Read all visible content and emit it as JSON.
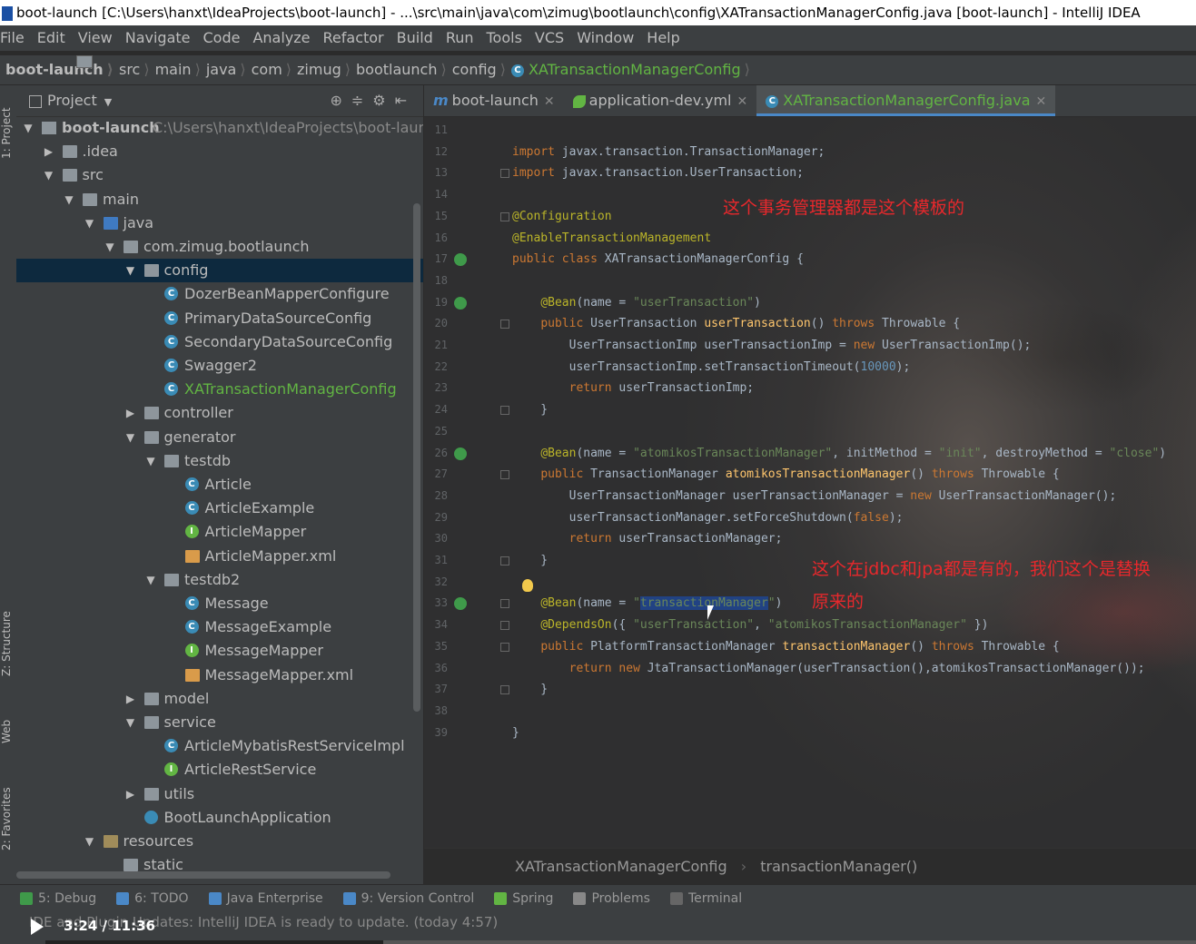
{
  "window": {
    "title": "boot-launch [C:\\Users\\hanxt\\IdeaProjects\\boot-launch] - ...\\src\\main\\java\\com\\zimug\\bootlaunch\\config\\XATransactionManagerConfig.java [boot-launch] - IntelliJ IDEA"
  },
  "menu": [
    "File",
    "Edit",
    "View",
    "Navigate",
    "Code",
    "Analyze",
    "Refactor",
    "Build",
    "Run",
    "Tools",
    "VCS",
    "Window",
    "Help"
  ],
  "nav": {
    "items": [
      "boot-launch",
      "src",
      "main",
      "java",
      "com",
      "zimug",
      "bootlaunch",
      "config",
      "XATransactionManagerConfig"
    ]
  },
  "left_strip": {
    "project": "1: Project",
    "structure": "Z: Structure",
    "web": "Web",
    "favorites": "2: Favorites"
  },
  "project_panel": {
    "title": "Project",
    "tree": [
      {
        "label": "boot-launch",
        "extra": "C:\\Users\\hanxt\\IdeaProjects\\boot-launch",
        "depth": 0,
        "arrow": "down",
        "icon": "proj"
      },
      {
        "label": ".idea",
        "depth": 1,
        "arrow": "right",
        "icon": "folder"
      },
      {
        "label": "src",
        "depth": 1,
        "arrow": "down",
        "icon": "folder"
      },
      {
        "label": "main",
        "depth": 2,
        "arrow": "down",
        "icon": "folder"
      },
      {
        "label": "java",
        "depth": 3,
        "arrow": "down",
        "icon": "folderblue"
      },
      {
        "label": "com.zimug.bootlaunch",
        "depth": 4,
        "arrow": "down",
        "icon": "folder"
      },
      {
        "label": "config",
        "depth": 5,
        "arrow": "down",
        "icon": "folder",
        "selected": true
      },
      {
        "label": "DozerBeanMapperConfigure",
        "depth": 6,
        "icon": "clsc"
      },
      {
        "label": "PrimaryDataSourceConfig",
        "depth": 6,
        "icon": "clsc"
      },
      {
        "label": "SecondaryDataSourceConfig",
        "depth": 6,
        "icon": "clsc"
      },
      {
        "label": "Swagger2",
        "depth": 6,
        "icon": "clsc"
      },
      {
        "label": "XATransactionManagerConfig",
        "depth": 6,
        "icon": "clsc",
        "green": true
      },
      {
        "label": "controller",
        "depth": 5,
        "arrow": "right",
        "icon": "folder"
      },
      {
        "label": "generator",
        "depth": 5,
        "arrow": "down",
        "icon": "folder"
      },
      {
        "label": "testdb",
        "depth": 6,
        "arrow": "down",
        "icon": "folder"
      },
      {
        "label": "Article",
        "depth": 7,
        "icon": "clsc"
      },
      {
        "label": "ArticleExample",
        "depth": 7,
        "icon": "clsc"
      },
      {
        "label": "ArticleMapper",
        "depth": 7,
        "icon": "ifc"
      },
      {
        "label": "ArticleMapper.xml",
        "depth": 7,
        "icon": "xml"
      },
      {
        "label": "testdb2",
        "depth": 6,
        "arrow": "down",
        "icon": "folder"
      },
      {
        "label": "Message",
        "depth": 7,
        "icon": "clsc"
      },
      {
        "label": "MessageExample",
        "depth": 7,
        "icon": "clsc"
      },
      {
        "label": "MessageMapper",
        "depth": 7,
        "icon": "ifc"
      },
      {
        "label": "MessageMapper.xml",
        "depth": 7,
        "icon": "xml"
      },
      {
        "label": "model",
        "depth": 5,
        "arrow": "right",
        "icon": "folder"
      },
      {
        "label": "service",
        "depth": 5,
        "arrow": "down",
        "icon": "folder"
      },
      {
        "label": "ArticleMybatisRestServiceImpl",
        "depth": 6,
        "icon": "clsc"
      },
      {
        "label": "ArticleRestService",
        "depth": 6,
        "icon": "ifc"
      },
      {
        "label": "utils",
        "depth": 5,
        "arrow": "right",
        "icon": "folder"
      },
      {
        "label": "BootLaunchApplication",
        "depth": 5,
        "icon": "app"
      },
      {
        "label": "resources",
        "depth": 3,
        "arrow": "down",
        "icon": "res"
      },
      {
        "label": "static",
        "depth": 4,
        "icon": "folder"
      }
    ]
  },
  "editor": {
    "tabs": [
      {
        "label": "boot-launch",
        "active": false,
        "type": "m"
      },
      {
        "label": "application-dev.yml",
        "active": false,
        "type": "leaf"
      },
      {
        "label": "XATransactionManagerConfig.java",
        "active": true,
        "type": "class"
      }
    ],
    "annotations": {
      "note1": "这个事务管理器都是这个模板的",
      "note2_line1": "这个在jdbc和jpa都是有的，我们这个是替换",
      "note2_line2": "原来的"
    },
    "breadcrumb": [
      "XATransactionManagerConfig",
      "transactionManager()"
    ]
  },
  "code_lines": [
    {
      "n": "11",
      "html": ""
    },
    {
      "n": "12",
      "html": "<span class='kw'>import</span> javax.transaction.TransactionManager;"
    },
    {
      "n": "13",
      "html": "<span class='kw'>import</span> javax.transaction.UserTransaction;"
    },
    {
      "n": "14",
      "html": ""
    },
    {
      "n": "15",
      "html": "<span class='an'>@Configuration</span>"
    },
    {
      "n": "16",
      "html": "<span class='an'>@EnableTransactionManagement</span>"
    },
    {
      "n": "17",
      "html": "<span class='kw'>public class</span> XATransactionManagerConfig {"
    },
    {
      "n": "18",
      "html": ""
    },
    {
      "n": "19",
      "html": "    <span class='an'>@Bean</span>(name = <span class='st'>\"userTransaction\"</span>)"
    },
    {
      "n": "20",
      "html": "    <span class='kw'>public</span> UserTransaction <span class='fn'>userTransaction</span>() <span class='kw'>throws</span> Throwable {"
    },
    {
      "n": "21",
      "html": "        UserTransactionImp userTransactionImp = <span class='kw'>new</span> UserTransactionImp();"
    },
    {
      "n": "22",
      "html": "        userTransactionImp.setTransactionTimeout(<span class='nm'>10000</span>);"
    },
    {
      "n": "23",
      "html": "        <span class='kw'>return</span> userTransactionImp;"
    },
    {
      "n": "24",
      "html": "    }"
    },
    {
      "n": "25",
      "html": ""
    },
    {
      "n": "26",
      "html": "    <span class='an'>@Bean</span>(name = <span class='st'>\"atomikosTransactionManager\"</span>, initMethod = <span class='st'>\"init\"</span>, destroyMethod = <span class='st'>\"close\"</span>)"
    },
    {
      "n": "27",
      "html": "    <span class='kw'>public</span> TransactionManager <span class='fn'>atomikosTransactionManager</span>() <span class='kw'>throws</span> Throwable {"
    },
    {
      "n": "28",
      "html": "        UserTransactionManager userTransactionManager = <span class='kw'>new</span> UserTransactionManager();"
    },
    {
      "n": "29",
      "html": "        userTransactionManager.setForceShutdown(<span class='kw'>false</span>);"
    },
    {
      "n": "30",
      "html": "        <span class='kw'>return</span> userTransactionManager;"
    },
    {
      "n": "31",
      "html": "    }"
    },
    {
      "n": "32",
      "html": ""
    },
    {
      "n": "33",
      "html": "    <span class='an'>@Bean</span>(name = <span class='st'>\"<span class='hl'>transactionManager</span>\"</span>)"
    },
    {
      "n": "34",
      "html": "    <span class='an'>@DependsOn</span>({ <span class='st'>\"userTransaction\"</span>, <span class='st'>\"atomikosTransactionManager\"</span> })"
    },
    {
      "n": "35",
      "html": "    <span class='kw'>public</span> PlatformTransactionManager <span class='fn'>transactionManager</span>() <span class='kw'>throws</span> Throwable {"
    },
    {
      "n": "36",
      "html": "        <span class='kw'>return new</span> JtaTransactionManager(userTransaction(),atomikosTransactionManager());"
    },
    {
      "n": "37",
      "html": "    }"
    },
    {
      "n": "38",
      "html": ""
    },
    {
      "n": "39",
      "html": "}"
    }
  ],
  "bottom_tools": [
    "5: Debug",
    "6: TODO",
    "Java Enterprise",
    "9: Version Control",
    "Spring",
    "Problems",
    "Terminal"
  ],
  "status": {
    "message": "IDE and Plugin Updates: IntelliJ IDEA is ready to update. (today 4:57)"
  },
  "player": {
    "time": "3:24 / 11:36",
    "progress_fraction": 0.294
  }
}
